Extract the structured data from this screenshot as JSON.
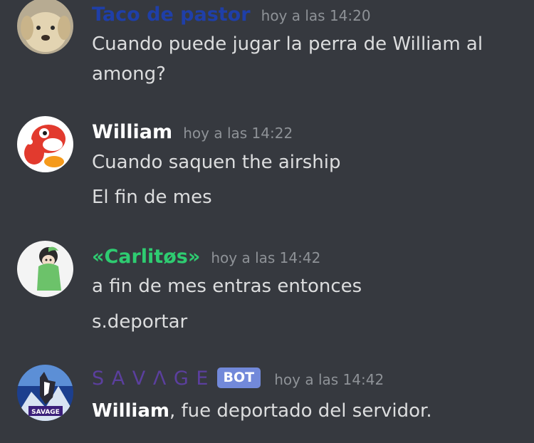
{
  "colors": {
    "background": "#36393f",
    "text": "#dcddde",
    "timestamp": "#8e9297",
    "bot_tag": "#7289da"
  },
  "messages": [
    {
      "author": "Taco de pastor",
      "author_color": "#1f3fa8",
      "avatar_icon": "puppy-avatar-icon",
      "timestamp": "hoy a las 14:20",
      "lines": [
        "Cuando puede jugar la perra de William al",
        "among?"
      ]
    },
    {
      "author": "William",
      "author_color": "#ffffff",
      "avatar_icon": "yoshi-avatar-icon",
      "timestamp": "hoy a las 14:22",
      "lines": [
        "Cuando saquen the airship",
        "El fin de mes"
      ]
    },
    {
      "author": "«Carlitøs»",
      "author_color": "#2ecc71",
      "avatar_icon": "green-hoodie-avatar-icon",
      "timestamp": "hoy a las 14:42",
      "lines": [
        "a fin de mes entras entonces",
        "s.deportar"
      ]
    },
    {
      "author": "S A V Λ G E",
      "author_color": "#5b3f9e",
      "avatar_icon": "wolf-savage-avatar-icon",
      "avatar_caption": "SAVAGE",
      "bot_tag": "BOT",
      "timestamp": "hoy a las 14:42",
      "lines": [
        {
          "bold": "William",
          "rest": ", fue deportado del servidor."
        }
      ]
    }
  ]
}
